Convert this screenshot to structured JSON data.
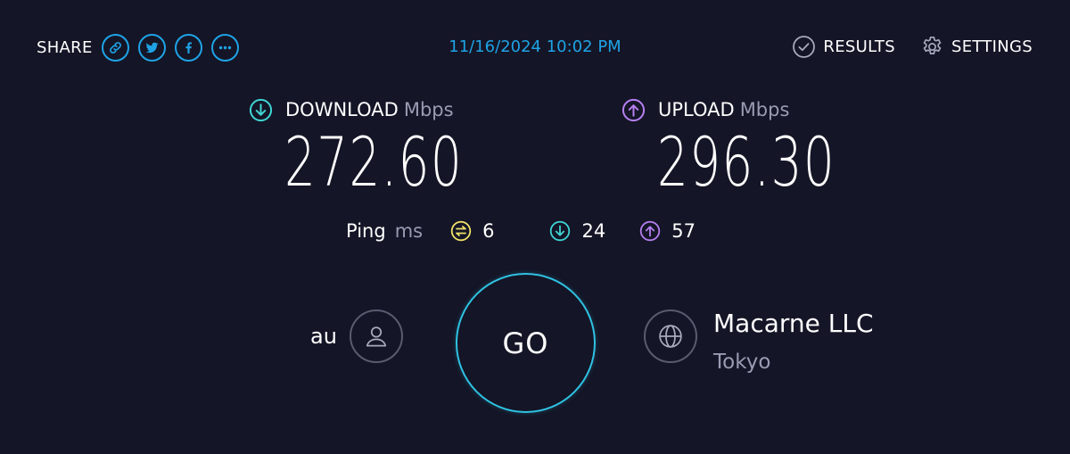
{
  "header": {
    "share_label": "SHARE",
    "share_buttons": [
      {
        "icon": "link-icon"
      },
      {
        "icon": "twitter-icon"
      },
      {
        "icon": "facebook-icon"
      },
      {
        "icon": "more-icon"
      }
    ],
    "datetime": "11/16/2024 10:02 PM",
    "results_label": "RESULTS",
    "settings_label": "SETTINGS"
  },
  "download": {
    "label": "DOWNLOAD",
    "unit": "Mbps",
    "value": "272.60",
    "color": "#3fd4d4"
  },
  "upload": {
    "label": "UPLOAD",
    "unit": "Mbps",
    "value": "296.30",
    "color": "#b57ff0"
  },
  "ping": {
    "label": "Ping",
    "unit": "ms",
    "idle": "6",
    "download": "24",
    "upload": "57",
    "idle_color": "#f0e06a"
  },
  "isp": {
    "name": "au"
  },
  "go_label": "GO",
  "server": {
    "name": "Macarne LLC",
    "location": "Tokyo"
  },
  "colors": {
    "background": "#141526",
    "accent": "#1fa3e6",
    "go_ring": "#2fc2e2"
  }
}
